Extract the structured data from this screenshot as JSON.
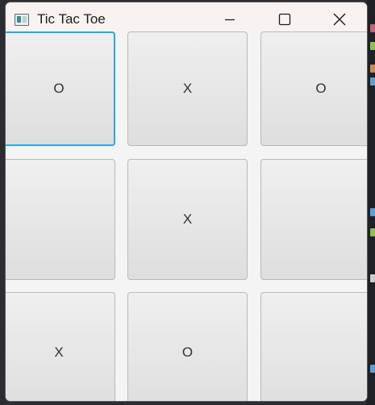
{
  "window": {
    "title": "Tic Tac Toe",
    "icon": "java-window-icon",
    "controls": {
      "minimize": "minimize-icon",
      "maximize": "maximize-icon",
      "close": "close-icon"
    }
  },
  "board": {
    "cells": [
      "O",
      "X",
      "O",
      "",
      "X",
      "",
      "X",
      "O",
      ""
    ],
    "focused_cell": 0,
    "focus_color": "#2aa7d9"
  }
}
